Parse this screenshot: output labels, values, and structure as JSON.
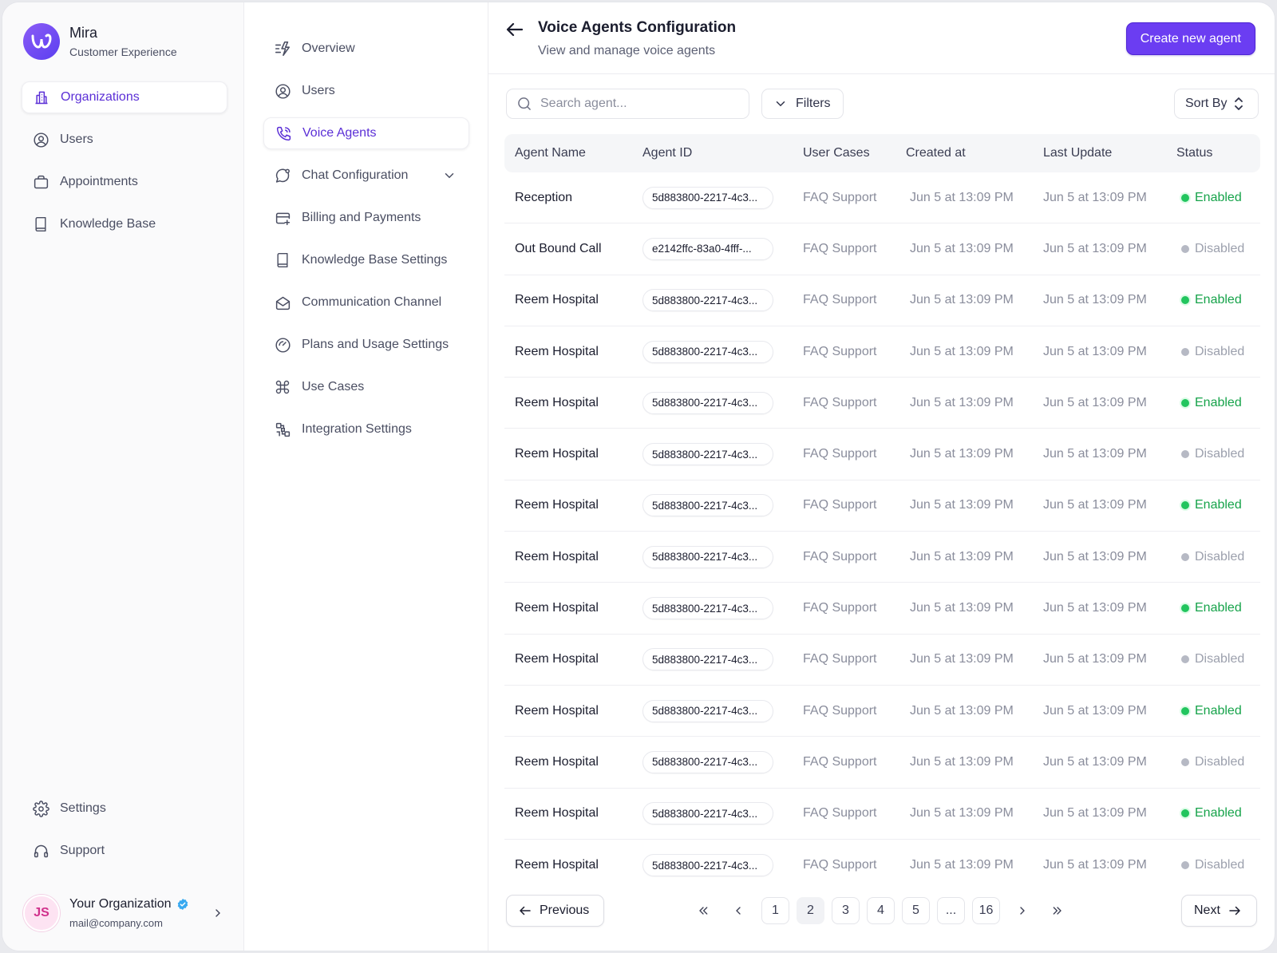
{
  "app": {
    "name": "Mira",
    "subtitle": "Customer Experience"
  },
  "sidebar": {
    "items": [
      {
        "label": "Organizations",
        "icon": "building-icon",
        "active": true
      },
      {
        "label": "Users",
        "icon": "user-circle-icon",
        "active": false
      },
      {
        "label": "Appointments",
        "icon": "briefcase-icon",
        "active": false
      },
      {
        "label": "Knowledge Base",
        "icon": "book-icon",
        "active": false
      }
    ],
    "bottom_items": [
      {
        "label": "Settings",
        "icon": "gear-icon"
      },
      {
        "label": "Support",
        "icon": "headset-icon"
      }
    ],
    "user": {
      "initials": "JS",
      "org_name": "Your Organization",
      "email": "mail@company.com"
    }
  },
  "subnav": {
    "items": [
      {
        "label": "Overview",
        "icon": "overview-icon",
        "active": false
      },
      {
        "label": "Users",
        "icon": "user-circle-icon",
        "active": false
      },
      {
        "label": "Voice Agents",
        "icon": "phone-icon",
        "active": true
      },
      {
        "label": "Chat Configuration",
        "icon": "chat-icon",
        "active": false
      },
      {
        "label": "Billing and Payments",
        "icon": "credit-card-icon",
        "active": false
      },
      {
        "label": "Knowledge Base Settings",
        "icon": "book-icon",
        "active": false
      },
      {
        "label": "Communication Channel",
        "icon": "envelope-icon",
        "active": false
      },
      {
        "label": "Plans and Usage Settings",
        "icon": "gauge-icon",
        "active": false
      },
      {
        "label": "Use Cases",
        "icon": "command-icon",
        "active": false
      },
      {
        "label": "Integration Settings",
        "icon": "integration-icon",
        "active": false
      }
    ]
  },
  "header": {
    "title": "Voice Agents Configuration",
    "subtitle": "View and manage voice agents",
    "create_label": "Create new agent"
  },
  "toolbar": {
    "search_placeholder": "Search agent...",
    "filters_label": "Filters",
    "sort_label": "Sort By"
  },
  "table": {
    "columns": [
      "Agent Name",
      "Agent ID",
      "User Cases",
      "Created at",
      "Last Update",
      "Status"
    ],
    "rows": [
      {
        "name": "Reception",
        "id": "5d883800-2217-4c3...",
        "case": "FAQ Support",
        "created": "Jun 5 at 13:09 PM",
        "updated": "Jun 5 at 13:09 PM",
        "status": "Enabled"
      },
      {
        "name": "Out Bound Call",
        "id": "e2142ffc-83a0-4fff-...",
        "case": "FAQ Support",
        "created": "Jun 5 at 13:09 PM",
        "updated": "Jun 5 at 13:09 PM",
        "status": "Disabled"
      },
      {
        "name": "Reem Hospital",
        "id": "5d883800-2217-4c3...",
        "case": "FAQ Support",
        "created": "Jun 5 at 13:09 PM",
        "updated": "Jun 5 at 13:09 PM",
        "status": "Enabled"
      },
      {
        "name": "Reem Hospital",
        "id": "5d883800-2217-4c3...",
        "case": "FAQ Support",
        "created": "Jun 5 at 13:09 PM",
        "updated": "Jun 5 at 13:09 PM",
        "status": "Disabled"
      },
      {
        "name": "Reem Hospital",
        "id": "5d883800-2217-4c3...",
        "case": "FAQ Support",
        "created": "Jun 5 at 13:09 PM",
        "updated": "Jun 5 at 13:09 PM",
        "status": "Enabled"
      },
      {
        "name": "Reem Hospital",
        "id": "5d883800-2217-4c3...",
        "case": "FAQ Support",
        "created": "Jun 5 at 13:09 PM",
        "updated": "Jun 5 at 13:09 PM",
        "status": "Disabled"
      },
      {
        "name": "Reem Hospital",
        "id": "5d883800-2217-4c3...",
        "case": "FAQ Support",
        "created": "Jun 5 at 13:09 PM",
        "updated": "Jun 5 at 13:09 PM",
        "status": "Enabled"
      },
      {
        "name": "Reem Hospital",
        "id": "5d883800-2217-4c3...",
        "case": "FAQ Support",
        "created": "Jun 5 at 13:09 PM",
        "updated": "Jun 5 at 13:09 PM",
        "status": "Disabled"
      },
      {
        "name": "Reem Hospital",
        "id": "5d883800-2217-4c3...",
        "case": "FAQ Support",
        "created": "Jun 5 at 13:09 PM",
        "updated": "Jun 5 at 13:09 PM",
        "status": "Enabled"
      },
      {
        "name": "Reem Hospital",
        "id": "5d883800-2217-4c3...",
        "case": "FAQ Support",
        "created": "Jun 5 at 13:09 PM",
        "updated": "Jun 5 at 13:09 PM",
        "status": "Disabled"
      },
      {
        "name": "Reem Hospital",
        "id": "5d883800-2217-4c3...",
        "case": "FAQ Support",
        "created": "Jun 5 at 13:09 PM",
        "updated": "Jun 5 at 13:09 PM",
        "status": "Enabled"
      },
      {
        "name": "Reem Hospital",
        "id": "5d883800-2217-4c3...",
        "case": "FAQ Support",
        "created": "Jun 5 at 13:09 PM",
        "updated": "Jun 5 at 13:09 PM",
        "status": "Disabled"
      },
      {
        "name": "Reem Hospital",
        "id": "5d883800-2217-4c3...",
        "case": "FAQ Support",
        "created": "Jun 5 at 13:09 PM",
        "updated": "Jun 5 at 13:09 PM",
        "status": "Enabled"
      },
      {
        "name": "Reem Hospital",
        "id": "5d883800-2217-4c3...",
        "case": "FAQ Support",
        "created": "Jun 5 at 13:09 PM",
        "updated": "Jun 5 at 13:09 PM",
        "status": "Disabled"
      }
    ]
  },
  "pagination": {
    "previous_label": "Previous",
    "next_label": "Next",
    "pages": [
      "1",
      "2",
      "3",
      "4",
      "5",
      "...",
      "16"
    ],
    "current": "2"
  },
  "colors": {
    "accent": "#6b3df2",
    "enabled": "#16a34a",
    "disabled": "#9ca0ad"
  }
}
